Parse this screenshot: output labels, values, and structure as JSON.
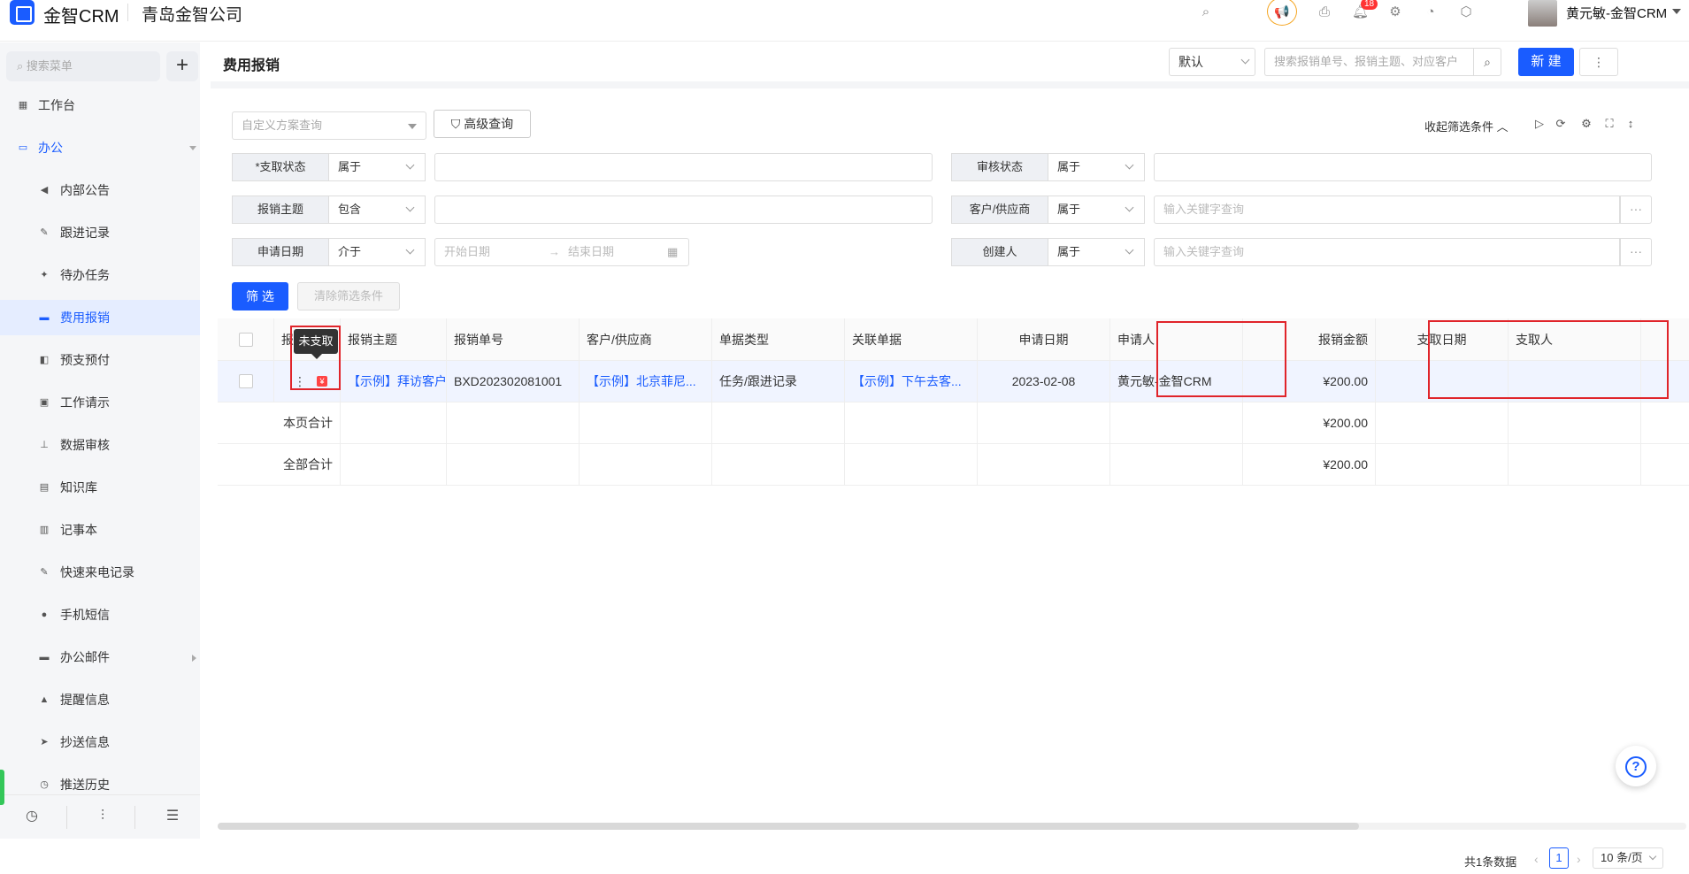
{
  "app": {
    "name": "金智CRM",
    "company": "青岛金智公司",
    "notification_count": "18",
    "user_name": "黄元敏-金智CRM"
  },
  "sidebar": {
    "search_placeholder": "搜索菜单",
    "items": [
      {
        "label": "工作台",
        "icon": "dashboard-icon"
      },
      {
        "label": "办公",
        "icon": "monitor-icon"
      },
      {
        "label": "内部公告",
        "icon": "speaker-icon"
      },
      {
        "label": "跟进记录",
        "icon": "edit-icon"
      },
      {
        "label": "待办任务",
        "icon": "pin-icon"
      },
      {
        "label": "费用报销",
        "icon": "card-icon"
      },
      {
        "label": "预支预付",
        "icon": "wallet-icon"
      },
      {
        "label": "工作请示",
        "icon": "message-icon"
      },
      {
        "label": "数据审核",
        "icon": "stamp-icon"
      },
      {
        "label": "知识库",
        "icon": "book-icon"
      },
      {
        "label": "记事本",
        "icon": "notebook-icon"
      },
      {
        "label": "快速来电记录",
        "icon": "edit-icon"
      },
      {
        "label": "手机短信",
        "icon": "chat-icon"
      },
      {
        "label": "办公邮件",
        "icon": "folder-icon"
      },
      {
        "label": "提醒信息",
        "icon": "bell-icon"
      },
      {
        "label": "抄送信息",
        "icon": "send-icon"
      },
      {
        "label": "推送历史",
        "icon": "clock-icon"
      }
    ]
  },
  "header": {
    "title": "费用报销",
    "view_select": "默认",
    "search_placeholder": "搜索报销单号、报销主题、对应客户",
    "new_button": "新 建"
  },
  "filters": {
    "scheme_placeholder": "自定义方案查询",
    "advanced": "高级查询",
    "collapse": "收起筛选条件",
    "rows": [
      {
        "label": "*支取状态",
        "op": "属于",
        "value": ""
      },
      {
        "label": "审核状态",
        "op": "属于",
        "value": ""
      },
      {
        "label": "报销主题",
        "op": "包含",
        "value": ""
      },
      {
        "label": "客户/供应商",
        "op": "属于",
        "value": "输入关键字查询"
      },
      {
        "label": "申请日期",
        "op": "介于",
        "start": "开始日期",
        "end": "结束日期"
      },
      {
        "label": "创建人",
        "op": "属于",
        "value": "输入关键字查询"
      }
    ],
    "filter_button": "筛 选",
    "clear_button": "清除筛选条件"
  },
  "table": {
    "columns": [
      "报",
      "报销主题",
      "报销单号",
      "客户/供应商",
      "单据类型",
      "关联单据",
      "申请日期",
      "申请人",
      "报销金额",
      "支取日期",
      "支取人"
    ],
    "rows": [
      {
        "subject": "【示例】拜访客户...",
        "number": "BXD202302081001",
        "customer": "【示例】北京菲尼...",
        "type": "任务/跟进记录",
        "related": "【示例】下午去客...",
        "date": "2023-02-08",
        "applicant": "黄元敏-金智CRM",
        "amount": "¥200.00",
        "pay_date": "",
        "payer": ""
      }
    ],
    "page_total_label": "本页合计",
    "page_total": "¥200.00",
    "all_total_label": "全部合计",
    "all_total": "¥200.00",
    "tooltip": "未支取"
  },
  "pager": {
    "total": "共1条数据",
    "page": "1",
    "page_size": "10 条/页"
  }
}
